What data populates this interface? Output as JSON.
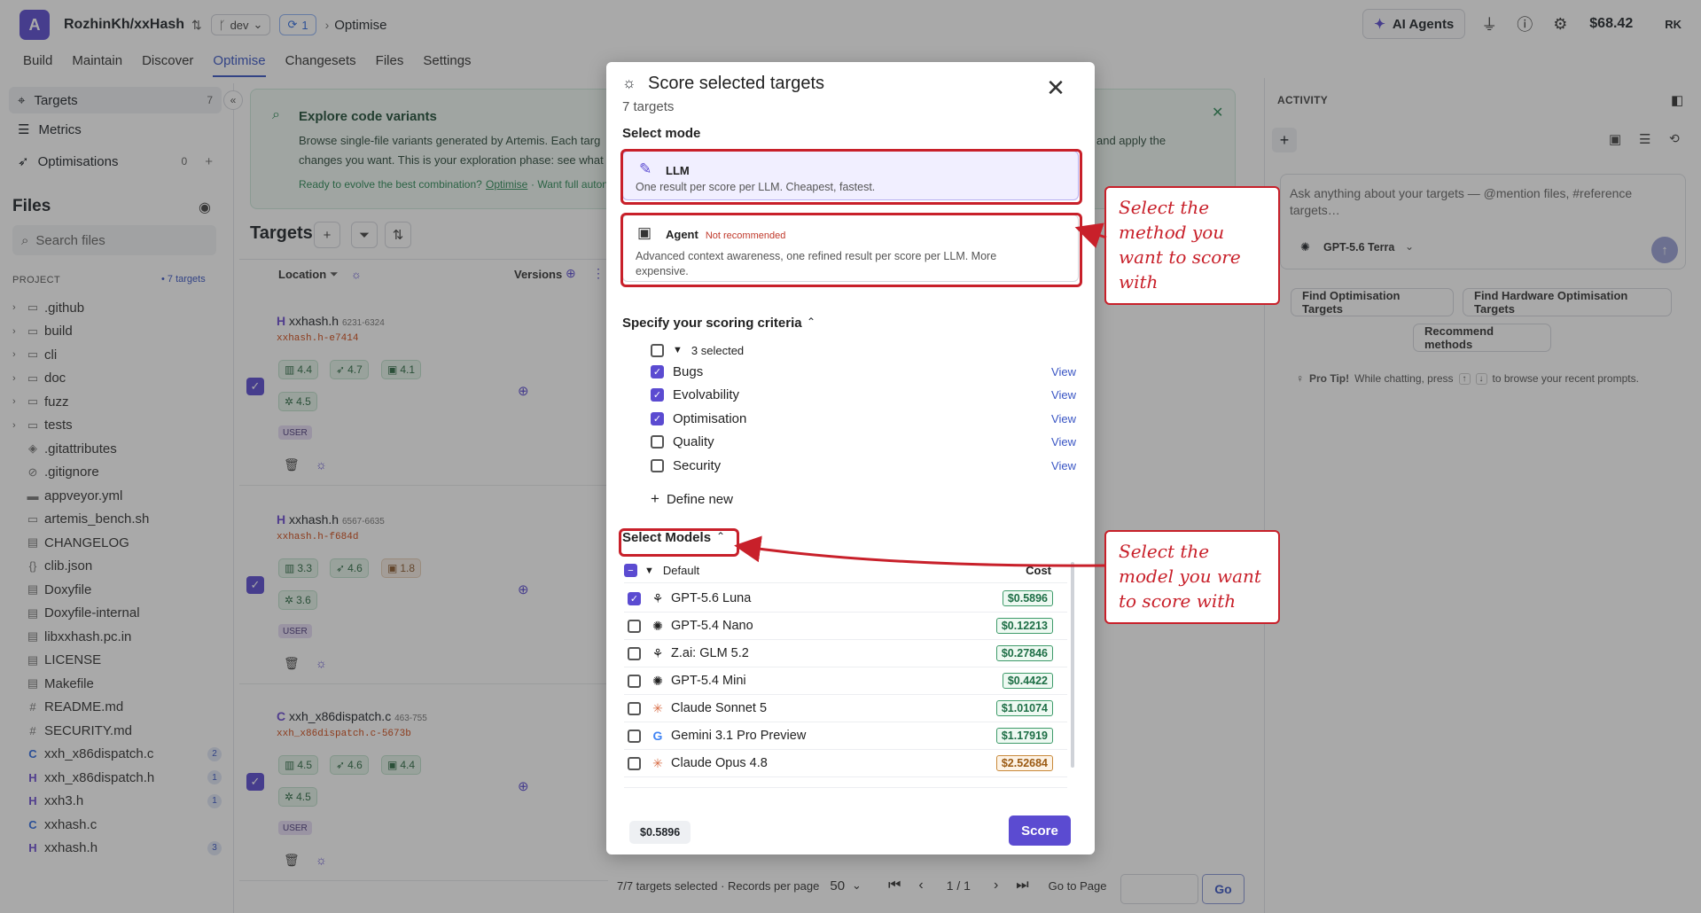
{
  "topbar": {
    "repo": "RozhinKh/xxHash",
    "branch": "dev",
    "sync_count": "1",
    "crumb": "Optimise",
    "ai_agents": "AI Agents",
    "balance": "$68.42",
    "initials": "RK"
  },
  "nav": {
    "tabs": [
      "Build",
      "Maintain",
      "Discover",
      "Optimise",
      "Changesets",
      "Files",
      "Settings"
    ],
    "active": "Optimise"
  },
  "sidebar": {
    "items": [
      {
        "label": "Targets",
        "count": "7"
      },
      {
        "label": "Metrics",
        "count": ""
      },
      {
        "label": "Optimisations",
        "count": "0"
      }
    ],
    "files_heading": "Files",
    "search_placeholder": "Search files",
    "project_label": "PROJECT",
    "project_targets": "• 7 targets",
    "tree": [
      {
        "type": "folder",
        "name": ".github"
      },
      {
        "type": "folder",
        "name": "build"
      },
      {
        "type": "folder",
        "name": "cli"
      },
      {
        "type": "folder",
        "name": "doc"
      },
      {
        "type": "folder",
        "name": "fuzz"
      },
      {
        "type": "folder",
        "name": "tests"
      },
      {
        "type": "file",
        "icon": "◈",
        "name": ".gitattributes"
      },
      {
        "type": "file",
        "icon": "⊘",
        "name": ".gitignore"
      },
      {
        "type": "file",
        "icon": "▬",
        "name": "appveyor.yml"
      },
      {
        "type": "file",
        "icon": "▭",
        "name": "artemis_bench.sh"
      },
      {
        "type": "file",
        "icon": "▤",
        "name": "CHANGELOG"
      },
      {
        "type": "file",
        "icon": "{}",
        "name": "clib.json"
      },
      {
        "type": "file",
        "icon": "▤",
        "name": "Doxyfile"
      },
      {
        "type": "file",
        "icon": "▤",
        "name": "Doxyfile-internal"
      },
      {
        "type": "file",
        "icon": "▤",
        "name": "libxxhash.pc.in"
      },
      {
        "type": "file",
        "icon": "▤",
        "name": "LICENSE"
      },
      {
        "type": "file",
        "icon": "▤",
        "name": "Makefile"
      },
      {
        "type": "file",
        "icon": "#",
        "name": "README.md"
      },
      {
        "type": "file",
        "icon": "#",
        "name": "SECURITY.md"
      },
      {
        "type": "file",
        "icon": "C",
        "name": "xxh_x86dispatch.c",
        "badge": "2"
      },
      {
        "type": "file",
        "icon": "H",
        "name": "xxh_x86dispatch.h",
        "badge": "1"
      },
      {
        "type": "file",
        "icon": "H",
        "name": "xxh3.h",
        "badge": "1"
      },
      {
        "type": "file",
        "icon": "C",
        "name": "xxhash.c"
      },
      {
        "type": "file",
        "icon": "H",
        "name": "xxhash.h",
        "badge": "3"
      }
    ]
  },
  "banner": {
    "title": "Explore code variants",
    "line1": "Browse single-file variants generated by Artemis. Each targ",
    "line1b": "and apply the",
    "line2": "changes you want. This is your exploration phase: see what",
    "line3": "Ready to evolve the best combination?",
    "link": "Optimise",
    "line3b": "· Want full auton"
  },
  "targets": {
    "heading": "Targets",
    "col_location": "Location",
    "col_versions": "Versions",
    "cards": [
      {
        "prefix": "H",
        "name": "xxhash.h",
        "range": "6231-6324",
        "sub": "xxhash.h-e7414",
        "m1": "4.4",
        "m2": "4.7",
        "m3": "4.1",
        "m4": "4.5",
        "badge": "USER"
      },
      {
        "prefix": "H",
        "name": "xxhash.h",
        "range": "6567-6635",
        "sub": "xxhash.h-f684d",
        "m1": "3.3",
        "m2": "4.6",
        "m3": "1.8",
        "m4": "3.6",
        "badge": "USER"
      },
      {
        "prefix": "C",
        "name": "xxh_x86dispatch.c",
        "range": "463-755",
        "sub": "xxh_x86dispatch.c-5673b",
        "m1": "4.5",
        "m2": "4.6",
        "m3": "4.4",
        "m4": "4.5",
        "badge": "USER"
      }
    ]
  },
  "footer": {
    "selected": "7/7 targets selected · Records per page",
    "per_page": "50",
    "page": "1 / 1",
    "goto": "Go to Page",
    "go": "Go"
  },
  "activity": {
    "heading": "ACTIVITY",
    "chat_placeholder": "Ask anything about your targets — @mention files, #reference targets…",
    "model": "GPT-5.6 Terra",
    "suggestions": [
      "Find Optimisation Targets",
      "Find Hardware Optimisation Targets",
      "Recommend methods"
    ],
    "tip_bold": "Pro Tip!",
    "tip": "While chatting, press",
    "tip_end": "to browse your recent prompts."
  },
  "modal": {
    "title": "Score selected targets",
    "subtitle": "7 targets",
    "mode_heading": "Select mode",
    "modes": [
      {
        "name": "LLM",
        "desc": "One result per score per LLM. Cheapest, fastest.",
        "selected": true
      },
      {
        "name": "Agent",
        "tag": "Not recommended",
        "desc": "Advanced context awareness, one refined result per score per LLM. More expensive.",
        "selected": false
      }
    ],
    "criteria_heading": "Specify your scoring criteria",
    "criteria_summary": "3 selected",
    "criteria": [
      {
        "label": "Bugs",
        "checked": true
      },
      {
        "label": "Evolvability",
        "checked": true
      },
      {
        "label": "Optimisation",
        "checked": true
      },
      {
        "label": "Quality",
        "checked": false
      },
      {
        "label": "Security",
        "checked": false
      }
    ],
    "view_label": "View",
    "define_new": "Define new",
    "models_heading": "Select Models",
    "group": "Default",
    "cost_label": "Cost",
    "models": [
      {
        "name": "GPT-5.6 Luna",
        "cost": "$0.5896",
        "checked": true,
        "icon": "⚘",
        "tone": "g"
      },
      {
        "name": "GPT-5.4 Nano",
        "cost": "$0.12213",
        "checked": false,
        "icon": "✺",
        "tone": "g"
      },
      {
        "name": "Z.ai: GLM 5.2",
        "cost": "$0.27846",
        "checked": false,
        "icon": "⚘",
        "tone": "g"
      },
      {
        "name": "GPT-5.4 Mini",
        "cost": "$0.4422",
        "checked": false,
        "icon": "✺",
        "tone": "g"
      },
      {
        "name": "Claude Sonnet 5",
        "cost": "$1.01074",
        "checked": false,
        "icon": "✳",
        "tone": "g"
      },
      {
        "name": "Gemini 3.1 Pro Preview",
        "cost": "$1.17919",
        "checked": false,
        "icon": "G",
        "tone": "g"
      },
      {
        "name": "Claude Opus 4.8",
        "cost": "$2.52684",
        "checked": false,
        "icon": "✳",
        "tone": "o"
      }
    ],
    "total": "$0.5896",
    "score_button": "Score"
  },
  "annotations": {
    "mode_callout": "Select the method you want to score with",
    "model_callout": "Select the model you want to score with"
  },
  "colors": {
    "accent": "#5b4bd1",
    "annotation": "#c8202a"
  }
}
